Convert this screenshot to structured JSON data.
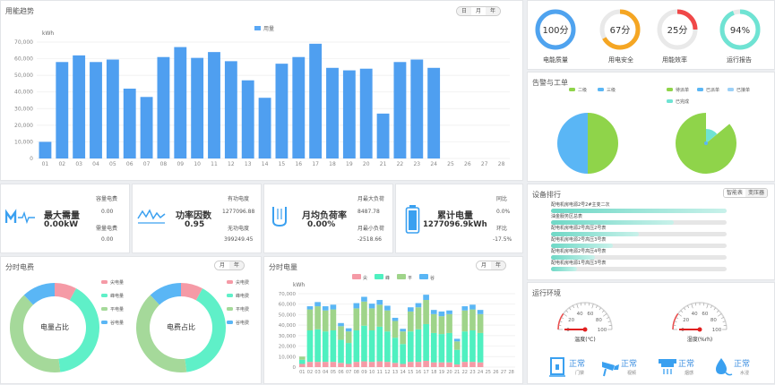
{
  "usage_trend": {
    "title": "用能趋势",
    "tabs": [
      "日",
      "月",
      "年"
    ],
    "active_tab": "月",
    "legend": "用量",
    "y_unit": "kWh"
  },
  "chart_data": [
    {
      "type": "bar",
      "title": "用能趋势",
      "ylabel": "kWh",
      "ylim": [
        0,
        70000
      ],
      "y_ticks": [
        "0",
        "10,000",
        "20,000",
        "30,000",
        "40,000",
        "50,000",
        "60,000",
        "70,000"
      ],
      "categories": [
        "01",
        "02",
        "03",
        "04",
        "05",
        "06",
        "07",
        "08",
        "09",
        "10",
        "11",
        "12",
        "13",
        "14",
        "15",
        "16",
        "17",
        "18",
        "19",
        "20",
        "21",
        "22",
        "23",
        "24",
        "25",
        "26",
        "27",
        "28"
      ],
      "series": [
        {
          "name": "用量",
          "values": [
            10000,
            58000,
            62000,
            58000,
            59500,
            42000,
            37000,
            61000,
            67000,
            60500,
            64000,
            58500,
            47000,
            36500,
            57000,
            61000,
            69000,
            54500,
            53000,
            54000,
            27000,
            58000,
            59500,
            54500,
            0,
            0,
            0,
            0
          ]
        }
      ]
    },
    {
      "type": "bar",
      "title": "分时电量",
      "ylabel": "kWh",
      "ylim": [
        0,
        70000
      ],
      "y_ticks": [
        "0",
        "10,000",
        "20,000",
        "30,000",
        "40,000",
        "50,000",
        "60,000",
        "70,000"
      ],
      "categories": [
        "01",
        "02",
        "03",
        "04",
        "05",
        "06",
        "07",
        "08",
        "09",
        "10",
        "11",
        "12",
        "13",
        "14",
        "15",
        "16",
        "17",
        "18",
        "19",
        "20",
        "21",
        "22",
        "23",
        "24",
        "25",
        "26",
        "27",
        "28"
      ],
      "series": [
        {
          "name": "尖",
          "values": [
            3000,
            5000,
            5000,
            5000,
            5000,
            4000,
            3000,
            5000,
            5500,
            5000,
            5500,
            5000,
            4000,
            3000,
            5000,
            5000,
            6000,
            4500,
            4500,
            4500,
            2500,
            5000,
            5000,
            4500,
            0,
            0,
            0,
            0
          ]
        },
        {
          "name": "峰",
          "values": [
            4000,
            30000,
            31000,
            29000,
            30000,
            22000,
            20000,
            30000,
            34000,
            30000,
            33000,
            29000,
            24000,
            19000,
            29000,
            31000,
            35000,
            28000,
            27000,
            28000,
            14000,
            29000,
            30000,
            28000,
            0,
            0,
            0,
            0
          ]
        },
        {
          "name": "平",
          "values": [
            3000,
            20000,
            22000,
            20000,
            20000,
            13000,
            11000,
            21000,
            23000,
            21000,
            21000,
            20000,
            16000,
            12000,
            19000,
            21000,
            23000,
            18000,
            17000,
            18000,
            8000,
            20000,
            20000,
            18000,
            0,
            0,
            0,
            0
          ]
        },
        {
          "name": "谷",
          "values": [
            0,
            3000,
            4000,
            4000,
            4500,
            3000,
            3000,
            5000,
            4500,
            4500,
            4500,
            4500,
            3000,
            2500,
            4000,
            4000,
            5000,
            4000,
            4500,
            3500,
            2500,
            4000,
            4500,
            4000,
            0,
            0,
            0,
            0
          ]
        }
      ]
    },
    {
      "type": "pie",
      "title": "电量占比",
      "categories": [
        "尖电量",
        "峰电量",
        "平电量",
        "谷电量"
      ],
      "values": [
        8,
        40,
        40,
        12
      ]
    },
    {
      "type": "pie",
      "title": "电费占比",
      "categories": [
        "尖电费",
        "峰电费",
        "平电费",
        "谷电费"
      ],
      "values": [
        8,
        40,
        40,
        12
      ]
    },
    {
      "type": "pie",
      "title": "告警与工单",
      "categories": [
        "二级",
        "三级"
      ],
      "values": [
        50,
        50
      ]
    },
    {
      "type": "pie",
      "title": "工单",
      "categories": [
        "待派单",
        "已派单",
        "已接单",
        "已完成"
      ],
      "values": [
        86,
        0,
        0,
        14
      ]
    }
  ],
  "scores": [
    {
      "value": "100分",
      "label": "电能质量",
      "fraction": 1.0,
      "color": "#4fa3ef"
    },
    {
      "value": "67分",
      "label": "用电安全",
      "fraction": 0.67,
      "color": "#f5a623"
    },
    {
      "value": "25分",
      "label": "用能效率",
      "fraction": 0.25,
      "color": "#f04848"
    },
    {
      "value": "94%",
      "label": "运行报告",
      "fraction": 0.94,
      "color": "#6fe3d3"
    }
  ],
  "stats": {
    "demand": {
      "title": "最大需量",
      "value": "0.00kW",
      "l1": "容量电费",
      "v1": "0.00",
      "l2": "需量电费",
      "v2": "0.00"
    },
    "power_factor": {
      "title": "功率因数",
      "value": "0.95",
      "l1": "有功电度",
      "v1": "1277096.88",
      "l2": "无功电度",
      "v2": "399249.45"
    },
    "load_rate": {
      "title": "月均负荷率",
      "value": "0.00%",
      "l1": "月最大负荷",
      "v1": "8487.78",
      "l2": "月最小负荷",
      "v2": "-2518.66"
    },
    "cumulative": {
      "title": "累计电量",
      "value": "1277096.9kWh",
      "l1": "同比",
      "v1": "0.0%",
      "l2": "环比",
      "v2": "-17.5%"
    }
  },
  "fee_panel": {
    "title": "分时电费",
    "tabs": [
      "月",
      "年"
    ],
    "active_tab": "月",
    "donut1_center": "电量占比",
    "donut1_legend": [
      "尖电量",
      "峰电量",
      "平电量",
      "谷电量"
    ],
    "donut2_center": "电费占比",
    "donut2_legend": [
      "尖电费",
      "峰电费",
      "平电费",
      "谷电费"
    ]
  },
  "energy_panel": {
    "title": "分时电量",
    "tabs": [
      "月",
      "年"
    ],
    "active_tab": "月",
    "legend": [
      "尖",
      "峰",
      "平",
      "谷"
    ],
    "y_unit": "kWh"
  },
  "alarm": {
    "title": "告警与工单",
    "legend_left": [
      "二级",
      "三级"
    ],
    "legend_right": [
      "待派单",
      "已派单",
      "已接单",
      "已完成"
    ]
  },
  "ranking": {
    "title": "设备排行",
    "tabs": [
      "智能表",
      "变压器"
    ],
    "active_tab": "智能表",
    "items": [
      {
        "label": "配电机房电源2号2#主变二次",
        "fraction": 1.0
      },
      {
        "label": "油金服务区总表",
        "fraction": 0.7
      },
      {
        "label": "配电机房电源2号高压2号表",
        "fraction": 0.5
      },
      {
        "label": "配电机房电源2号高压3号表",
        "fraction": 0.35
      },
      {
        "label": "配电机房电源2号高压4号表",
        "fraction": 0.25
      },
      {
        "label": "配电机房电源1号高压3号表",
        "fraction": 0.15
      }
    ]
  },
  "environment": {
    "title": "运行环境",
    "temp": {
      "label": "温度(℃)",
      "ticks": [
        "0",
        "20",
        "40",
        "60",
        "80",
        "100"
      ],
      "level": 0.0
    },
    "humidity": {
      "label": "湿度(%rh)",
      "ticks": [
        "0",
        "20",
        "40",
        "60",
        "80",
        "100"
      ],
      "level": 0.0
    },
    "items": [
      {
        "status": "正常",
        "name": "门禁",
        "icon": "lock-icon"
      },
      {
        "status": "正常",
        "name": "视频",
        "icon": "camera-icon"
      },
      {
        "status": "正常",
        "name": "烟感",
        "icon": "smoke-detector-icon"
      },
      {
        "status": "正常",
        "name": "水浸",
        "icon": "water-leak-icon"
      }
    ]
  }
}
